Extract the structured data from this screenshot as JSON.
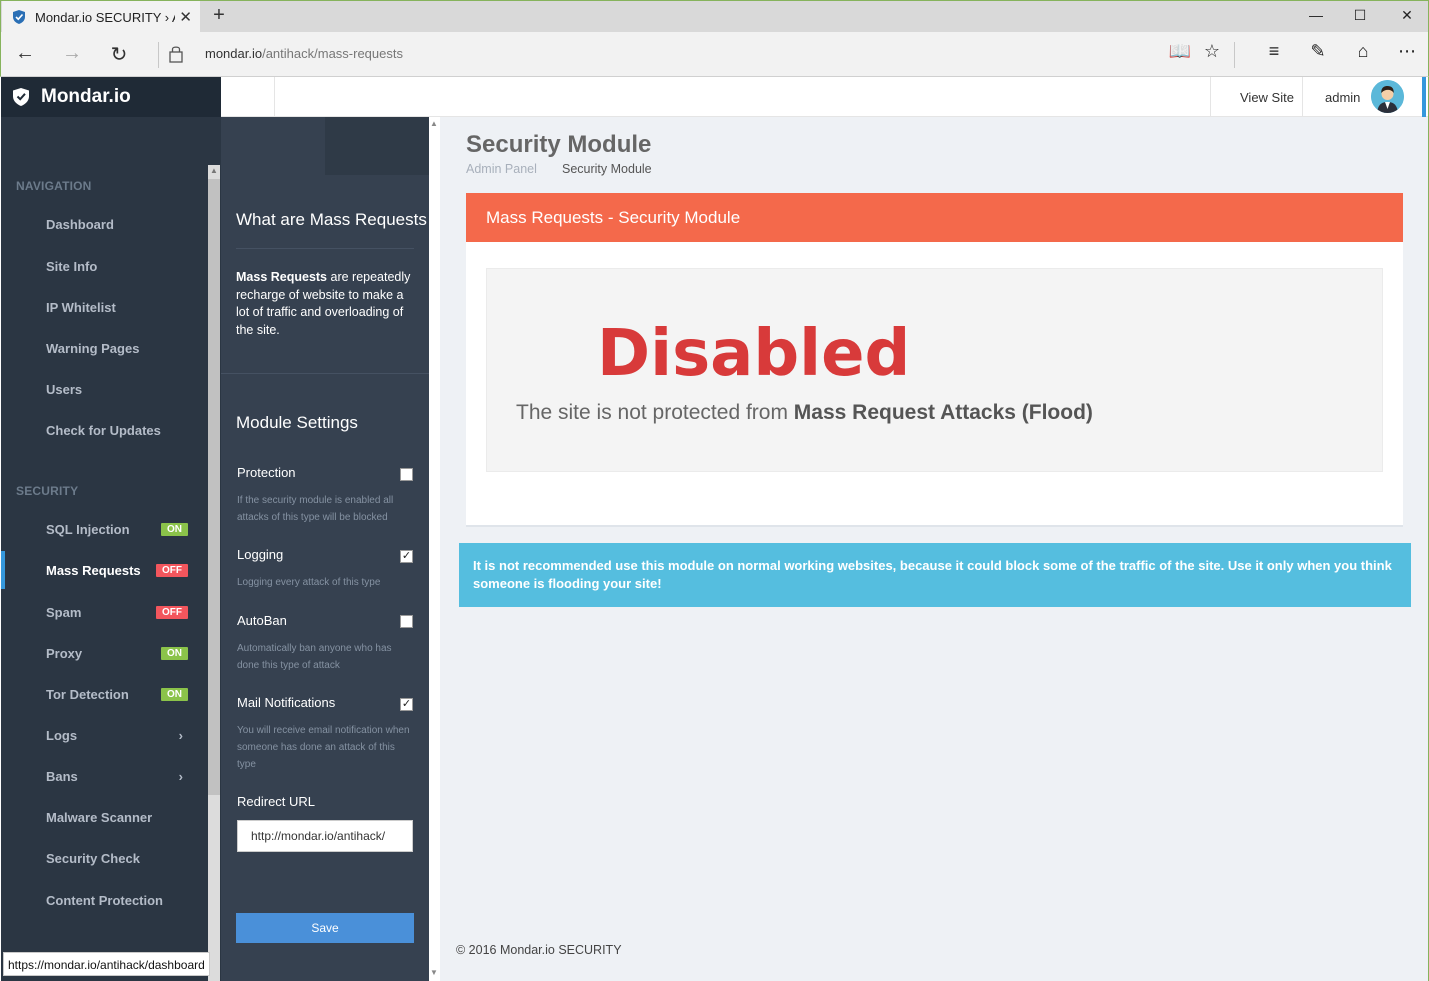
{
  "browser": {
    "tab_title": "Mondar.io SECURITY › A",
    "url_host": "mondar.io",
    "url_path": "/antihack/mass-requests",
    "status_bar_url": "https://mondar.io/antihack/dashboard"
  },
  "brand": {
    "name": "Mondar.io"
  },
  "sidebar": {
    "navigation_title": "NAVIGATION",
    "navigation_items": [
      {
        "label": "Dashboard"
      },
      {
        "label": "Site Info"
      },
      {
        "label": "IP Whitelist"
      },
      {
        "label": "Warning Pages"
      },
      {
        "label": "Users"
      },
      {
        "label": "Check for Updates"
      }
    ],
    "security_title": "SECURITY",
    "security_items": [
      {
        "label": "SQL Injection",
        "badge": "ON"
      },
      {
        "label": "Mass Requests",
        "badge": "OFF",
        "active": true
      },
      {
        "label": "Spam",
        "badge": "OFF"
      },
      {
        "label": "Proxy",
        "badge": "ON"
      },
      {
        "label": "Tor Detection",
        "badge": "ON"
      },
      {
        "label": "Logs",
        "has_submenu": true
      },
      {
        "label": "Bans",
        "has_submenu": true
      },
      {
        "label": "Malware Scanner"
      },
      {
        "label": "Security Check"
      },
      {
        "label": "Content Protection"
      }
    ]
  },
  "header": {
    "view_site": "View Site",
    "user_name": "admin"
  },
  "settings_panel": {
    "info_heading": "What are Mass Requests",
    "info_bold": "Mass Requests",
    "info_text": " are repeatedly recharge of website to make a lot of traffic and overloading of the site.",
    "settings_heading": "Module Settings",
    "options": [
      {
        "label": "Protection",
        "help": "If the security module is enabled all attacks of this type will be blocked",
        "checked": false
      },
      {
        "label": "Logging",
        "help": "Logging every attack of this type",
        "checked": true
      },
      {
        "label": "AutoBan",
        "help": "Automatically ban anyone who has done this type of attack",
        "checked": false
      },
      {
        "label": "Mail Notifications",
        "help": "You will receive email notification when someone has done an attack of this type",
        "checked": true
      }
    ],
    "redirect_label": "Redirect URL",
    "redirect_value": "http://mondar.io/antihack/",
    "save_label": "Save"
  },
  "main": {
    "page_title": "Security Module",
    "breadcrumb": [
      "Admin Panel",
      "Security Module"
    ],
    "portlet_title": "Mass Requests - Security Module",
    "status_word": "Disabled",
    "status_text": "The site is not protected from ",
    "status_bold": "Mass Request Attacks (Flood)",
    "note": "It is not recommended use this module on normal working websites, because it could block some of the traffic of the site. Use it only when you think someone is flooding your site!",
    "footer": "© 2016 Mondar.io SECURITY"
  },
  "colors": {
    "sidebar_bg": "#2b3643",
    "panel_bg": "#364150",
    "accent_red": "#f4694b",
    "disabled_red": "#d83a3a",
    "info_blue": "#55bedf",
    "badge_on": "#8bc34a",
    "badge_off": "#f3565d",
    "save_blue": "#4a90d9"
  }
}
